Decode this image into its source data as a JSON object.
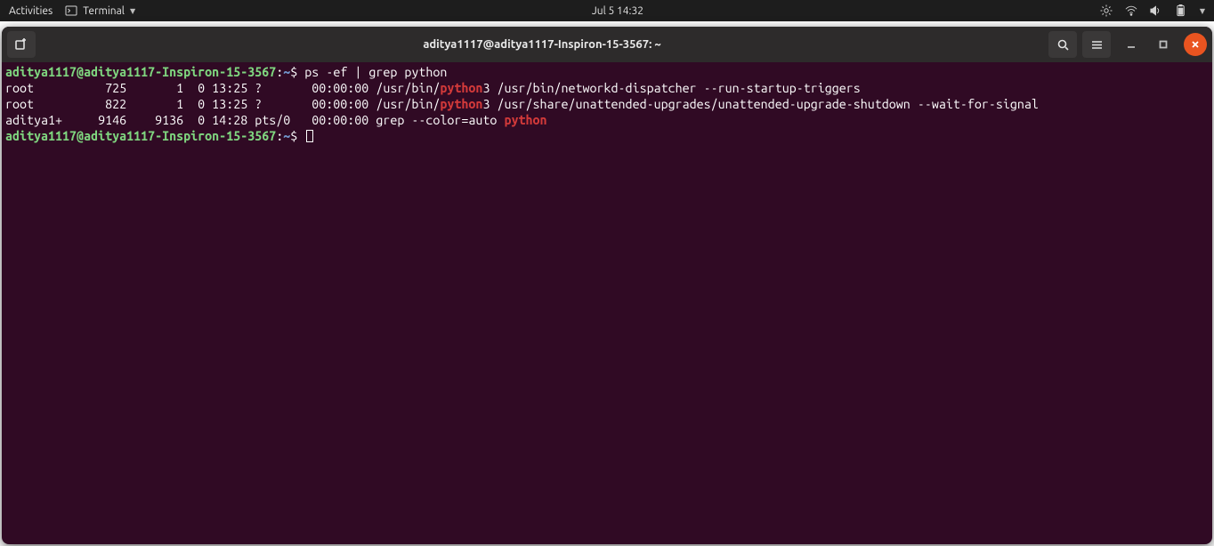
{
  "topbar": {
    "activities": "Activities",
    "app_label": "Terminal",
    "datetime": "Jul 5  14:32"
  },
  "window": {
    "title": "aditya1117@aditya1117-Inspiron-15-3567: ~"
  },
  "prompt": {
    "user_host": "aditya1117@aditya1117-Inspiron-15-3567",
    "sep": ":",
    "path": "~",
    "sigil": "$"
  },
  "commands": {
    "cmd1": "ps -ef | grep python"
  },
  "rows": [
    {
      "uid": "root",
      "pid": "725",
      "ppid": "1",
      "c": "0",
      "stime": "13:25",
      "tty": "?",
      "time": "00:00:00",
      "cmd_a": "/usr/bin/",
      "cmd_hl": "python",
      "cmd_b": "3 /usr/bin/networkd-dispatcher --run-startup-triggers"
    },
    {
      "uid": "root",
      "pid": "822",
      "ppid": "1",
      "c": "0",
      "stime": "13:25",
      "tty": "?",
      "time": "00:00:00",
      "cmd_a": "/usr/bin/",
      "cmd_hl": "python",
      "cmd_b": "3 /usr/share/unattended-upgrades/unattended-upgrade-shutdown --wait-for-signal"
    },
    {
      "uid": "aditya1+",
      "pid": "9146",
      "ppid": "9136",
      "c": "0",
      "stime": "14:28",
      "tty": "pts/0",
      "time": "00:00:00",
      "cmd_a": "grep --color=auto ",
      "cmd_hl": "python",
      "cmd_b": ""
    }
  ],
  "cols": {
    "uid": 9,
    "pid": 8,
    "ppid": 8,
    "c": 3,
    "stime": 6,
    "tty": 8,
    "time": 9
  }
}
